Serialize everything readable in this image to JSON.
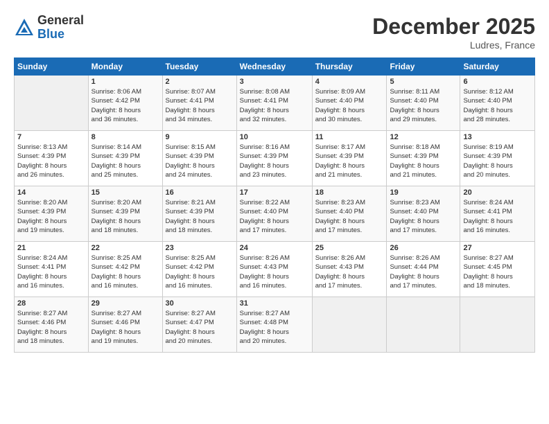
{
  "logo": {
    "general": "General",
    "blue": "Blue"
  },
  "header": {
    "title": "December 2025",
    "location": "Ludres, France"
  },
  "columns": [
    "Sunday",
    "Monday",
    "Tuesday",
    "Wednesday",
    "Thursday",
    "Friday",
    "Saturday"
  ],
  "weeks": [
    [
      {
        "day": "",
        "info": ""
      },
      {
        "day": "1",
        "info": "Sunrise: 8:06 AM\nSunset: 4:42 PM\nDaylight: 8 hours\nand 36 minutes."
      },
      {
        "day": "2",
        "info": "Sunrise: 8:07 AM\nSunset: 4:41 PM\nDaylight: 8 hours\nand 34 minutes."
      },
      {
        "day": "3",
        "info": "Sunrise: 8:08 AM\nSunset: 4:41 PM\nDaylight: 8 hours\nand 32 minutes."
      },
      {
        "day": "4",
        "info": "Sunrise: 8:09 AM\nSunset: 4:40 PM\nDaylight: 8 hours\nand 30 minutes."
      },
      {
        "day": "5",
        "info": "Sunrise: 8:11 AM\nSunset: 4:40 PM\nDaylight: 8 hours\nand 29 minutes."
      },
      {
        "day": "6",
        "info": "Sunrise: 8:12 AM\nSunset: 4:40 PM\nDaylight: 8 hours\nand 28 minutes."
      }
    ],
    [
      {
        "day": "7",
        "info": "Sunrise: 8:13 AM\nSunset: 4:39 PM\nDaylight: 8 hours\nand 26 minutes."
      },
      {
        "day": "8",
        "info": "Sunrise: 8:14 AM\nSunset: 4:39 PM\nDaylight: 8 hours\nand 25 minutes."
      },
      {
        "day": "9",
        "info": "Sunrise: 8:15 AM\nSunset: 4:39 PM\nDaylight: 8 hours\nand 24 minutes."
      },
      {
        "day": "10",
        "info": "Sunrise: 8:16 AM\nSunset: 4:39 PM\nDaylight: 8 hours\nand 23 minutes."
      },
      {
        "day": "11",
        "info": "Sunrise: 8:17 AM\nSunset: 4:39 PM\nDaylight: 8 hours\nand 21 minutes."
      },
      {
        "day": "12",
        "info": "Sunrise: 8:18 AM\nSunset: 4:39 PM\nDaylight: 8 hours\nand 21 minutes."
      },
      {
        "day": "13",
        "info": "Sunrise: 8:19 AM\nSunset: 4:39 PM\nDaylight: 8 hours\nand 20 minutes."
      }
    ],
    [
      {
        "day": "14",
        "info": "Sunrise: 8:20 AM\nSunset: 4:39 PM\nDaylight: 8 hours\nand 19 minutes."
      },
      {
        "day": "15",
        "info": "Sunrise: 8:20 AM\nSunset: 4:39 PM\nDaylight: 8 hours\nand 18 minutes."
      },
      {
        "day": "16",
        "info": "Sunrise: 8:21 AM\nSunset: 4:39 PM\nDaylight: 8 hours\nand 18 minutes."
      },
      {
        "day": "17",
        "info": "Sunrise: 8:22 AM\nSunset: 4:40 PM\nDaylight: 8 hours\nand 17 minutes."
      },
      {
        "day": "18",
        "info": "Sunrise: 8:23 AM\nSunset: 4:40 PM\nDaylight: 8 hours\nand 17 minutes."
      },
      {
        "day": "19",
        "info": "Sunrise: 8:23 AM\nSunset: 4:40 PM\nDaylight: 8 hours\nand 17 minutes."
      },
      {
        "day": "20",
        "info": "Sunrise: 8:24 AM\nSunset: 4:41 PM\nDaylight: 8 hours\nand 16 minutes."
      }
    ],
    [
      {
        "day": "21",
        "info": "Sunrise: 8:24 AM\nSunset: 4:41 PM\nDaylight: 8 hours\nand 16 minutes."
      },
      {
        "day": "22",
        "info": "Sunrise: 8:25 AM\nSunset: 4:42 PM\nDaylight: 8 hours\nand 16 minutes."
      },
      {
        "day": "23",
        "info": "Sunrise: 8:25 AM\nSunset: 4:42 PM\nDaylight: 8 hours\nand 16 minutes."
      },
      {
        "day": "24",
        "info": "Sunrise: 8:26 AM\nSunset: 4:43 PM\nDaylight: 8 hours\nand 16 minutes."
      },
      {
        "day": "25",
        "info": "Sunrise: 8:26 AM\nSunset: 4:43 PM\nDaylight: 8 hours\nand 17 minutes."
      },
      {
        "day": "26",
        "info": "Sunrise: 8:26 AM\nSunset: 4:44 PM\nDaylight: 8 hours\nand 17 minutes."
      },
      {
        "day": "27",
        "info": "Sunrise: 8:27 AM\nSunset: 4:45 PM\nDaylight: 8 hours\nand 18 minutes."
      }
    ],
    [
      {
        "day": "28",
        "info": "Sunrise: 8:27 AM\nSunset: 4:46 PM\nDaylight: 8 hours\nand 18 minutes."
      },
      {
        "day": "29",
        "info": "Sunrise: 8:27 AM\nSunset: 4:46 PM\nDaylight: 8 hours\nand 19 minutes."
      },
      {
        "day": "30",
        "info": "Sunrise: 8:27 AM\nSunset: 4:47 PM\nDaylight: 8 hours\nand 20 minutes."
      },
      {
        "day": "31",
        "info": "Sunrise: 8:27 AM\nSunset: 4:48 PM\nDaylight: 8 hours\nand 20 minutes."
      },
      {
        "day": "",
        "info": ""
      },
      {
        "day": "",
        "info": ""
      },
      {
        "day": "",
        "info": ""
      }
    ]
  ]
}
